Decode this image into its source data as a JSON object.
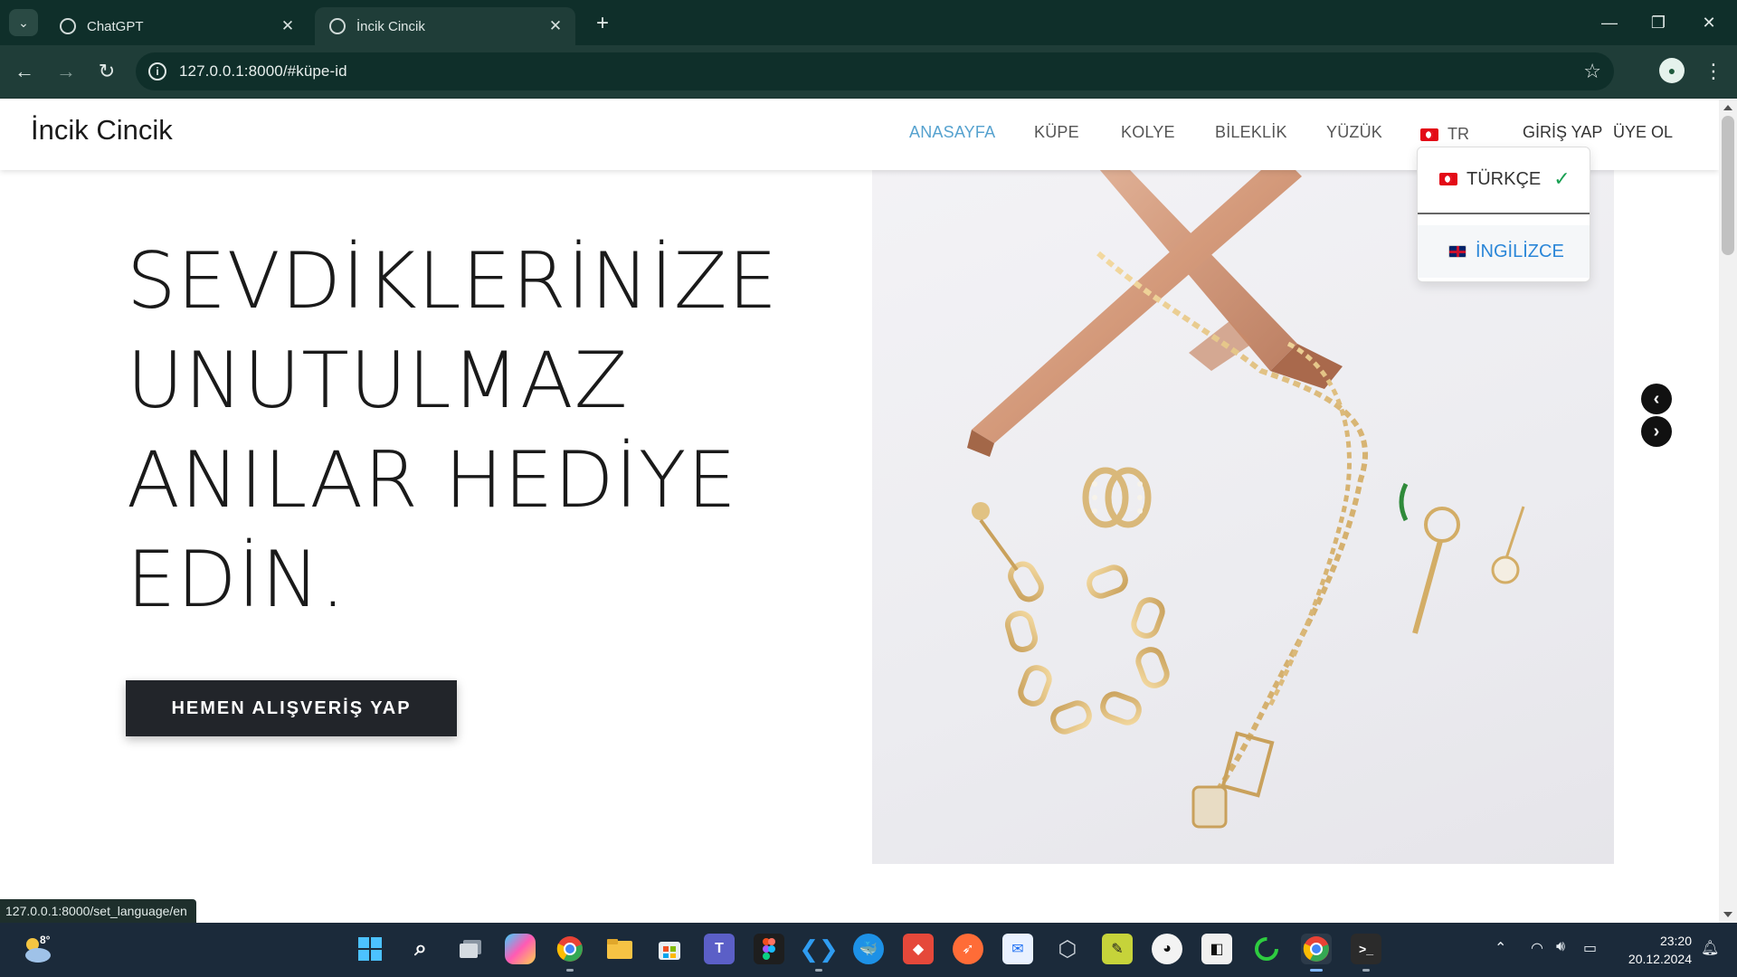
{
  "browser": {
    "tabs": [
      {
        "title": "ChatGPT",
        "active": false
      },
      {
        "title": "İncik Cincik",
        "active": true
      }
    ],
    "url": "127.0.0.1:8000/#küpe-id",
    "status_url": "127.0.0.1:8000/set_language/en"
  },
  "site": {
    "brand": "İncik Cincik",
    "menu": [
      {
        "label": "ANASAYFA",
        "active": true
      },
      {
        "label": "KÜPE",
        "active": false
      },
      {
        "label": "KOLYE",
        "active": false
      },
      {
        "label": "BİLEKLİK",
        "active": false
      },
      {
        "label": "YÜZÜK",
        "active": false
      }
    ],
    "lang_toggle": "TR",
    "login": "GİRİŞ YAP",
    "register": "ÜYE OL",
    "lang_options": [
      {
        "label": "TÜRKÇE",
        "selected": true
      },
      {
        "label": "İNGİLİZCE",
        "selected": false
      }
    ],
    "hero": {
      "lines": [
        "SEVDİKLERİNİZE",
        "UNUTULMAZ",
        "ANILAR HEDİYE",
        "EDİN."
      ],
      "cta": "HEMEN ALIŞVERİŞ YAP"
    },
    "accent_color": "#56a2cf"
  },
  "taskbar": {
    "weather_temp": "8°",
    "time": "23:20",
    "date": "20.12.2024"
  }
}
